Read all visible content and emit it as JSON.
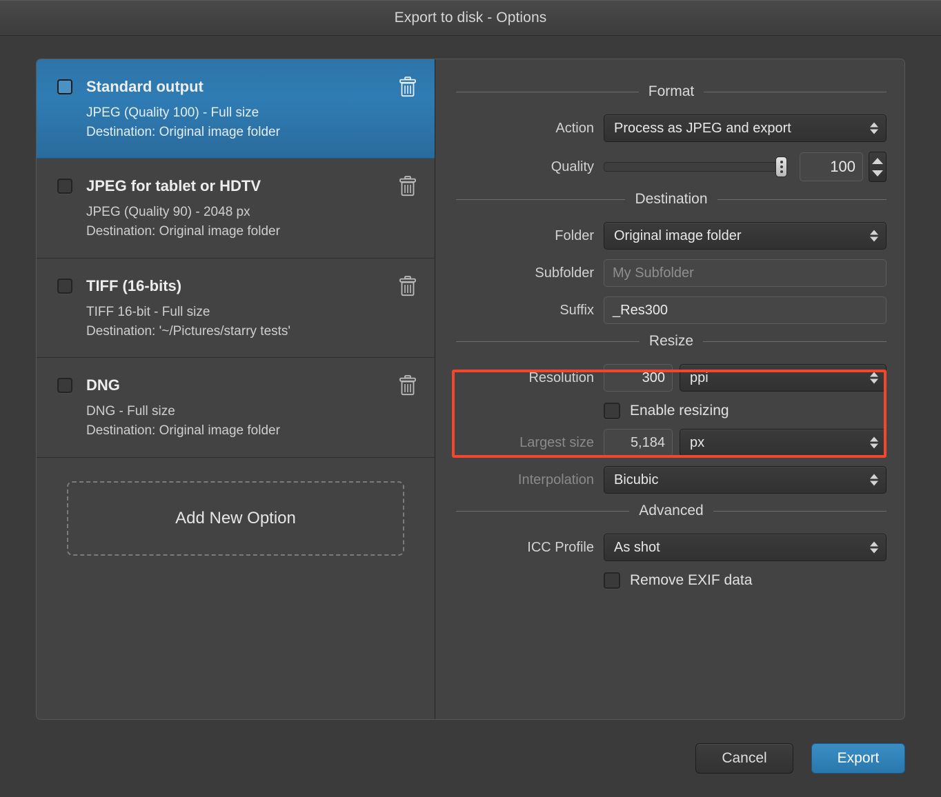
{
  "window": {
    "title": "Export to disk - Options"
  },
  "presets": {
    "items": [
      {
        "title": "Standard output",
        "line1": "JPEG (Quality 100) - Full size",
        "line2": "Destination: Original image folder",
        "selected": true
      },
      {
        "title": "JPEG for tablet or HDTV",
        "line1": "JPEG (Quality 90) - 2048 px",
        "line2": "Destination: Original image folder",
        "selected": false
      },
      {
        "title": "TIFF (16-bits)",
        "line1": "TIFF 16-bit - Full size",
        "line2": "Destination: '~/Pictures/starry tests'",
        "selected": false
      },
      {
        "title": "DNG",
        "line1": "DNG - Full size",
        "line2": "Destination: Original image folder",
        "selected": false
      }
    ],
    "add_button_label": "Add New Option",
    "delete_icon": "trash-icon"
  },
  "options": {
    "format": {
      "section_label": "Format",
      "action_label": "Action",
      "action_value": "Process as JPEG and export",
      "quality_label": "Quality",
      "quality_value": "100",
      "quality_slider_percent": 100
    },
    "destination": {
      "section_label": "Destination",
      "folder_label": "Folder",
      "folder_value": "Original image folder",
      "subfolder_label": "Subfolder",
      "subfolder_value": "",
      "subfolder_placeholder": "My Subfolder",
      "suffix_label": "Suffix",
      "suffix_value": "_Res300"
    },
    "resize": {
      "section_label": "Resize",
      "resolution_label": "Resolution",
      "resolution_value": "300",
      "resolution_unit": "ppi",
      "enable_resizing_label": "Enable resizing",
      "enable_resizing_checked": false,
      "largest_size_label": "Largest size",
      "largest_size_value": "5,184",
      "largest_size_unit": "px",
      "interpolation_label": "Interpolation",
      "interpolation_value": "Bicubic"
    },
    "advanced": {
      "section_label": "Advanced",
      "icc_profile_label": "ICC Profile",
      "icc_profile_value": "As shot",
      "remove_exif_label": "Remove EXIF data",
      "remove_exif_checked": false
    },
    "highlight_color": "#f4462a"
  },
  "footer": {
    "cancel_label": "Cancel",
    "export_label": "Export"
  },
  "colors": {
    "accent_blue": "#2f7cb4",
    "panel_bg": "#434343",
    "window_bg": "#3b3b3b",
    "highlight_red": "#f4462a"
  }
}
